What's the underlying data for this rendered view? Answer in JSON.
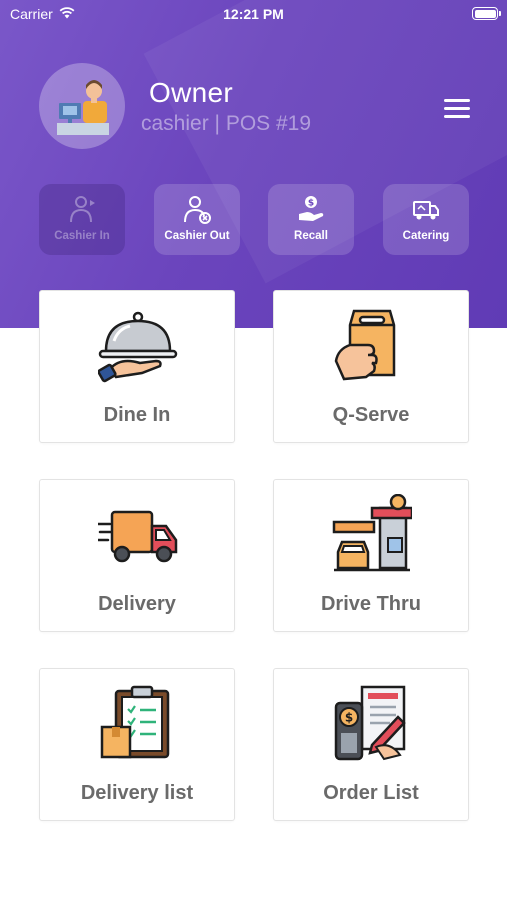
{
  "status_bar": {
    "carrier": "Carrier",
    "time": "12:21 PM",
    "icons": [
      "wifi-icon",
      "battery-icon"
    ]
  },
  "profile": {
    "name": "Owner",
    "role": "cashier | POS #19",
    "avatar_icon": "cashier-avatar-icon",
    "menu_icon": "hamburger-menu-icon"
  },
  "quick_actions": [
    {
      "label": "Cashier In",
      "icon": "cashier-in-icon",
      "enabled": false
    },
    {
      "label": "Cashier Out",
      "icon": "cashier-out-icon",
      "enabled": true
    },
    {
      "label": "Recall",
      "icon": "recall-icon",
      "enabled": true
    },
    {
      "label": "Catering",
      "icon": "catering-truck-icon",
      "enabled": true
    }
  ],
  "cards": [
    {
      "label": "Dine In",
      "icon": "cloche-serving-icon"
    },
    {
      "label": "Q-Serve",
      "icon": "takeaway-bag-icon"
    },
    {
      "label": "Delivery",
      "icon": "delivery-truck-icon"
    },
    {
      "label": "Drive Thru",
      "icon": "drive-thru-icon"
    },
    {
      "label": "Delivery list",
      "icon": "clipboard-checklist-icon"
    },
    {
      "label": "Order List",
      "icon": "order-receipt-icon"
    }
  ],
  "colors": {
    "header_purple": "#6b45bd",
    "card_label": "#6a6a6a",
    "card_border": "#e3e3e3"
  }
}
